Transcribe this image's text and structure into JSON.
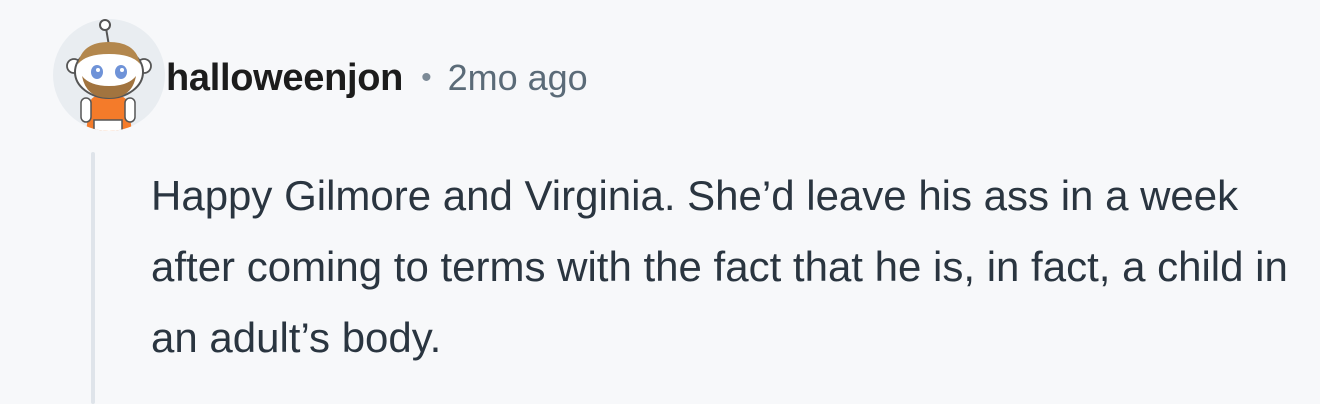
{
  "comment": {
    "author": "halloweenjon",
    "separator": "•",
    "timestamp": "2mo ago",
    "body": "Happy Gilmore and Virginia. She’d leave his ass in a week after coming to terms with the fact that he is, in fact, a child in an adult’s body.",
    "avatar_icon": "reddit-snoo-avatar-icon"
  },
  "colors": {
    "background": "#f7f8fa",
    "username": "#1c1c1c",
    "timestamp": "#5b6b78",
    "body_text": "#2a3540",
    "thread_line": "#dfe4ea",
    "avatar_shirt": "#f47b2a"
  }
}
